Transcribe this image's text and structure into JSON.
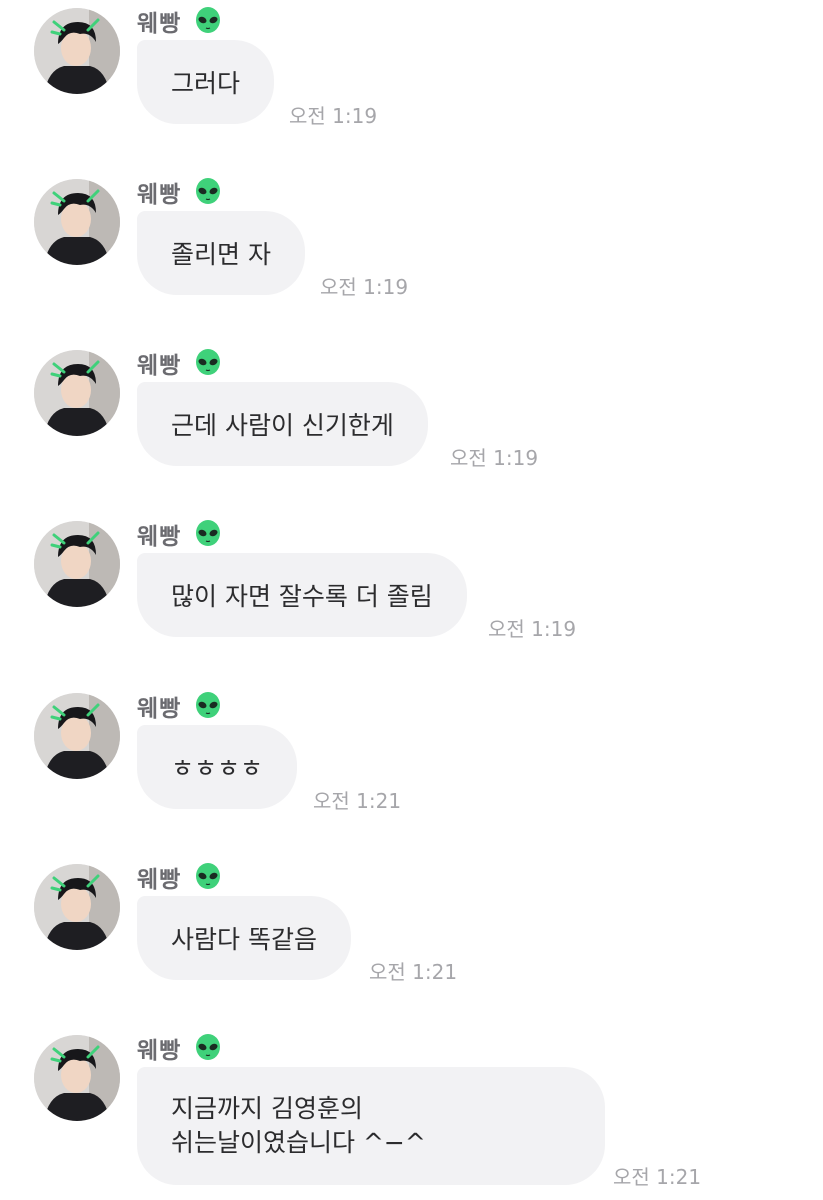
{
  "chat": {
    "messages": [
      {
        "sender": "웨빵",
        "text": "그러다",
        "time": "오전 1:19"
      },
      {
        "sender": "웨빵",
        "text": "졸리면 자",
        "time": "오전 1:19"
      },
      {
        "sender": "웨빵",
        "text": "근데 사람이 신기한게",
        "time": "오전 1:19"
      },
      {
        "sender": "웨빵",
        "text": "많이 자면 잘수록 더 졸림",
        "time": "오전 1:19"
      },
      {
        "sender": "웨빵",
        "text": "ㅎㅎㅎㅎ",
        "time": "오전 1:21"
      },
      {
        "sender": "웨빵",
        "text": "사람다 똑같음",
        "time": "오전 1:21"
      },
      {
        "sender": "웨빵",
        "lines": [
          "지금까지 김영훈의",
          "쉬는날이였습니다 ^−^"
        ],
        "time": "오전 1:21"
      }
    ],
    "sender_badge_icon": "alien-icon",
    "colors": {
      "bubble": "#f2f2f4",
      "text": "#2c2c2e",
      "time": "#a6a6aa",
      "sender": "#6b6b70",
      "alien": "#3fd17a"
    }
  }
}
